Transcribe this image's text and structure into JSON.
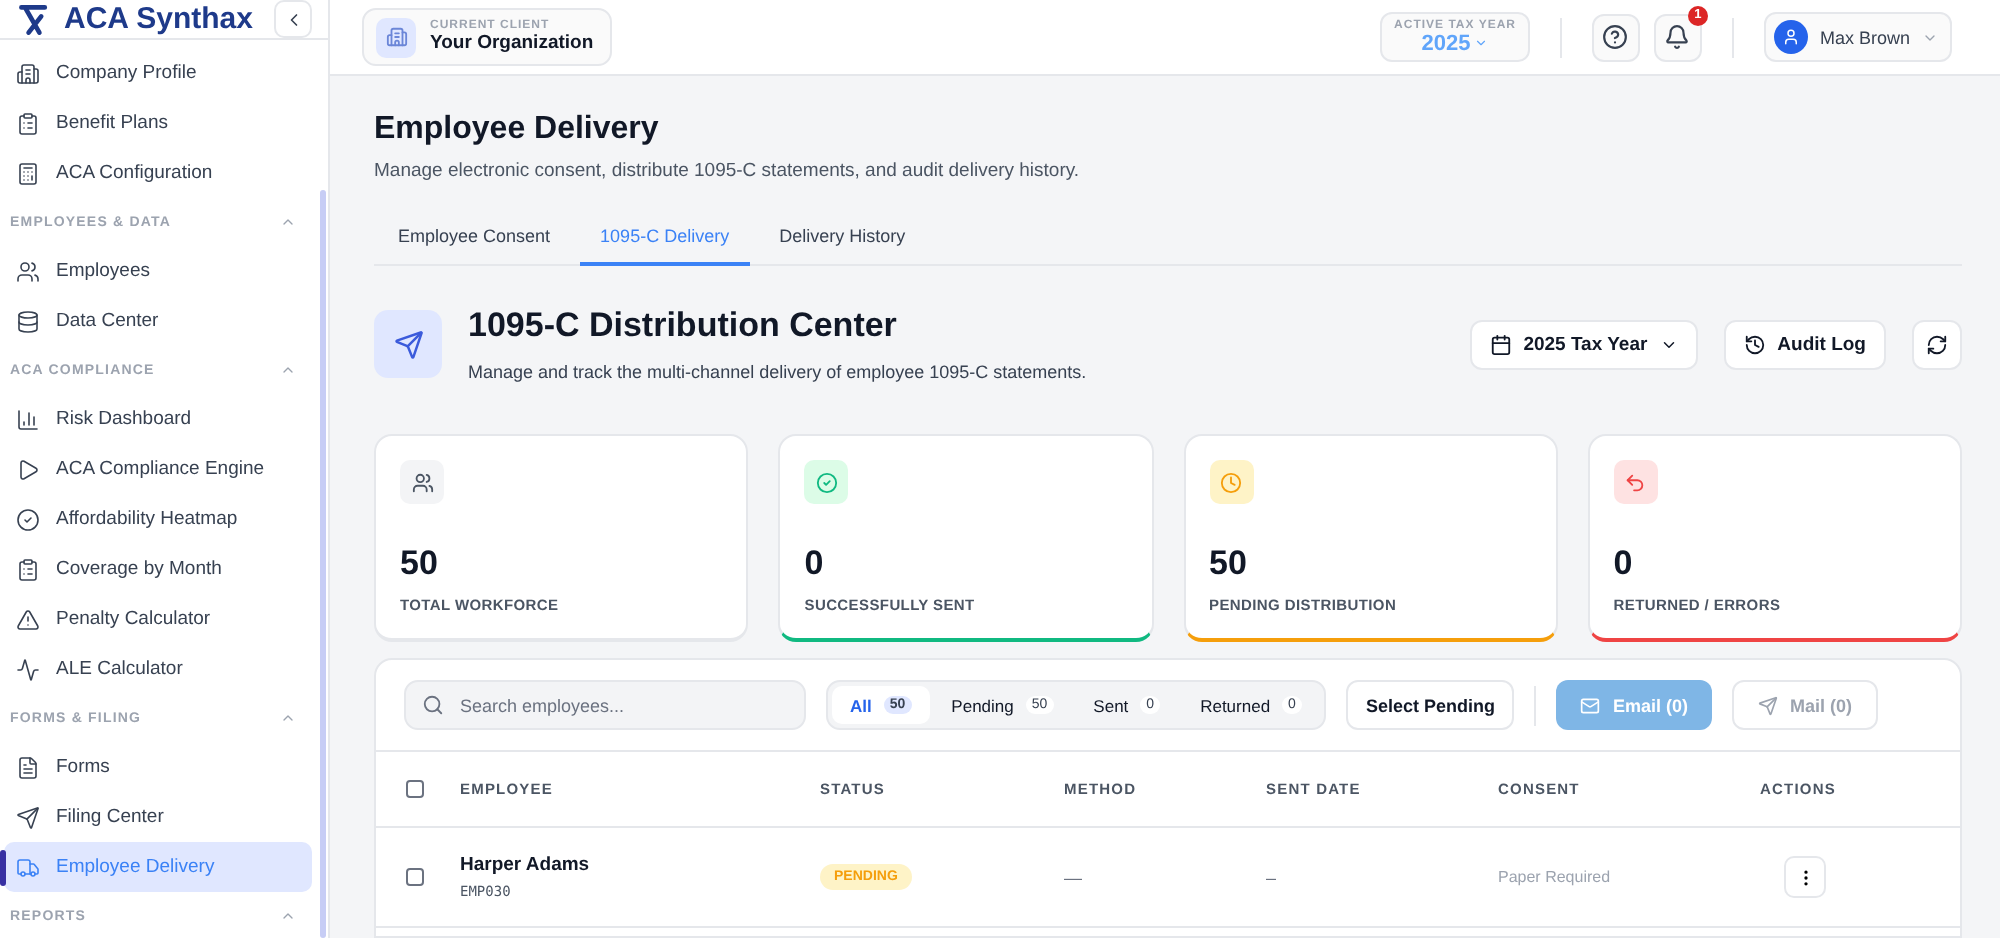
{
  "brand": {
    "name": "ACA Synthax"
  },
  "sidebar": {
    "top_items": [
      {
        "label": "Company Profile",
        "selected": false
      },
      {
        "label": "Benefit Plans",
        "selected": false
      },
      {
        "label": "ACA Configuration",
        "selected": false
      }
    ],
    "sections": [
      {
        "title": "EMPLOYEES & DATA",
        "expanded": true,
        "items": [
          {
            "label": "Employees",
            "selected": false
          },
          {
            "label": "Data Center",
            "selected": false
          }
        ]
      },
      {
        "title": "ACA COMPLIANCE",
        "expanded": true,
        "items": [
          {
            "label": "Risk Dashboard",
            "selected": false
          },
          {
            "label": "ACA Compliance Engine",
            "selected": false
          },
          {
            "label": "Affordability Heatmap",
            "selected": false
          },
          {
            "label": "Coverage by Month",
            "selected": false
          },
          {
            "label": "Penalty Calculator",
            "selected": false
          },
          {
            "label": "ALE Calculator",
            "selected": false
          }
        ]
      },
      {
        "title": "FORMS & FILING",
        "expanded": true,
        "items": [
          {
            "label": "Forms",
            "selected": false
          },
          {
            "label": "Filing Center",
            "selected": false
          },
          {
            "label": "Employee Delivery",
            "selected": true
          }
        ]
      },
      {
        "title": "REPORTS",
        "expanded": true
      }
    ]
  },
  "header": {
    "client_label": "CURRENT CLIENT",
    "client_name": "Your Organization",
    "tax_year_label": "ACTIVE TAX YEAR",
    "tax_year": "2025",
    "notification_count": "1",
    "user_name": "Max Brown"
  },
  "page": {
    "title": "Employee Delivery",
    "subtitle": "Manage electronic consent, distribute 1095-C statements, and audit delivery history.",
    "tabs": [
      {
        "label": "Employee Consent",
        "selected": false
      },
      {
        "label": "1095-C Delivery",
        "selected": true
      },
      {
        "label": "Delivery History",
        "selected": false
      }
    ]
  },
  "center": {
    "title": "1095-C Distribution Center",
    "subtitle": "Manage and track the multi-channel delivery of employee 1095-C statements.",
    "year_button": "2025 Tax Year",
    "audit_button": "Audit Log"
  },
  "stats": [
    {
      "value": "50",
      "label": "TOTAL WORKFORCE",
      "kind": "neutral"
    },
    {
      "value": "0",
      "label": "SUCCESSFULLY SENT",
      "kind": "success"
    },
    {
      "value": "50",
      "label": "PENDING DISTRIBUTION",
      "kind": "warning"
    },
    {
      "value": "0",
      "label": "RETURNED / ERRORS",
      "kind": "danger"
    }
  ],
  "toolbar": {
    "search_placeholder": "Search employees...",
    "filters": [
      {
        "label": "All",
        "count": "50",
        "selected": true
      },
      {
        "label": "Pending",
        "count": "50",
        "selected": false
      },
      {
        "label": "Sent",
        "count": "0",
        "selected": false
      },
      {
        "label": "Returned",
        "count": "0",
        "selected": false
      }
    ],
    "select_button": "Select Pending",
    "email_button": {
      "label": "Email (0)",
      "disabled": true
    },
    "mail_button": {
      "label": "Mail (0)",
      "disabled": true
    }
  },
  "table": {
    "select_all_checked": false,
    "columns": [
      "EMPLOYEE",
      "STATUS",
      "METHOD",
      "SENT DATE",
      "CONSENT",
      "ACTIONS"
    ],
    "rows": [
      {
        "name": "Harper Adams",
        "id": "EMP030",
        "status": "PENDING",
        "method": "—",
        "sent_date": "–",
        "consent": "Paper Required",
        "checked": false
      }
    ]
  }
}
